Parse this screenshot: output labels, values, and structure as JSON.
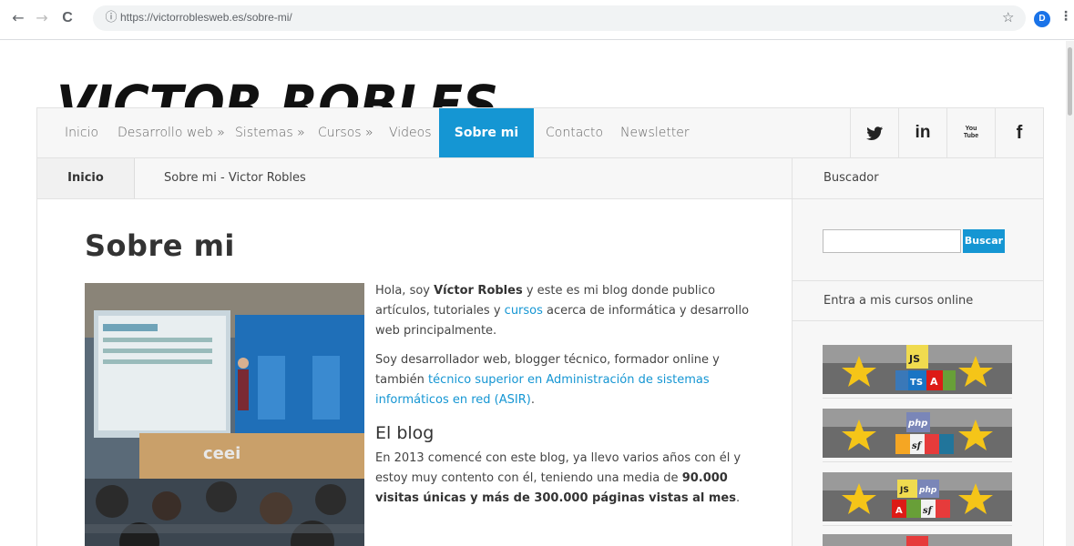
{
  "browser": {
    "back": "←",
    "forward": "→",
    "reload": "C",
    "info_icon": "ⓘ",
    "url": "https://victorroblesweb.es/sobre-mi/",
    "star": "☆",
    "profile_initial": "D",
    "menu": "⋮"
  },
  "site": {
    "logo_text": "VICTOR ROBLES",
    "accent_color": "#1596d3"
  },
  "menu": {
    "items": [
      {
        "label": "Inicio"
      },
      {
        "label": "Desarrollo web »"
      },
      {
        "label": "Sistemas »"
      },
      {
        "label": "Cursos »"
      },
      {
        "label": "Videos"
      },
      {
        "label": "Sobre mi"
      },
      {
        "label": "Contacto"
      },
      {
        "label": "Newsletter"
      }
    ],
    "social": [
      {
        "icon": "twitter-icon",
        "glyph": "🐦"
      },
      {
        "icon": "linkedin-icon",
        "glyph": "in"
      },
      {
        "icon": "youtube-icon",
        "glyph": "You Tube"
      },
      {
        "icon": "facebook-icon",
        "glyph": "f"
      }
    ]
  },
  "breadcrumb": {
    "home": "Inicio",
    "current": "Sobre mi - Victor Robles"
  },
  "article": {
    "title": "Sobre mi",
    "p1_a": "Hola, soy ",
    "p1_b": "Víctor Robles",
    "p1_c": " y este es mi blog donde publico artículos, tutoriales y ",
    "p1_link": "cursos",
    "p1_d": " acerca de informática y desarrollo web principalmente.",
    "p2_a": "Soy desarrollador web, blogger técnico, formador online y también ",
    "p2_link": "técnico superior en Administración de sistemas informáticos en red (ASIR)",
    "p2_b": ".",
    "subheading": "El blog",
    "p3_a": "En 2013 comencé con este blog, ya llevo varios años con él y estoy muy contento con él, teniendo una media de ",
    "p3_b": "90.000 visitas únicas y más de 300.000 páginas vistas al mes",
    "p3_c": "."
  },
  "sidebar": {
    "search_title": "Buscador",
    "search_button": "Buscar",
    "courses_title": "Entra a mis cursos online",
    "courses": [
      {
        "badges": [
          "JS",
          "TS",
          "A"
        ]
      },
      {
        "badges": [
          "php",
          "sf"
        ]
      },
      {
        "badges": [
          "JS",
          "php",
          "A",
          "sf"
        ]
      }
    ]
  }
}
